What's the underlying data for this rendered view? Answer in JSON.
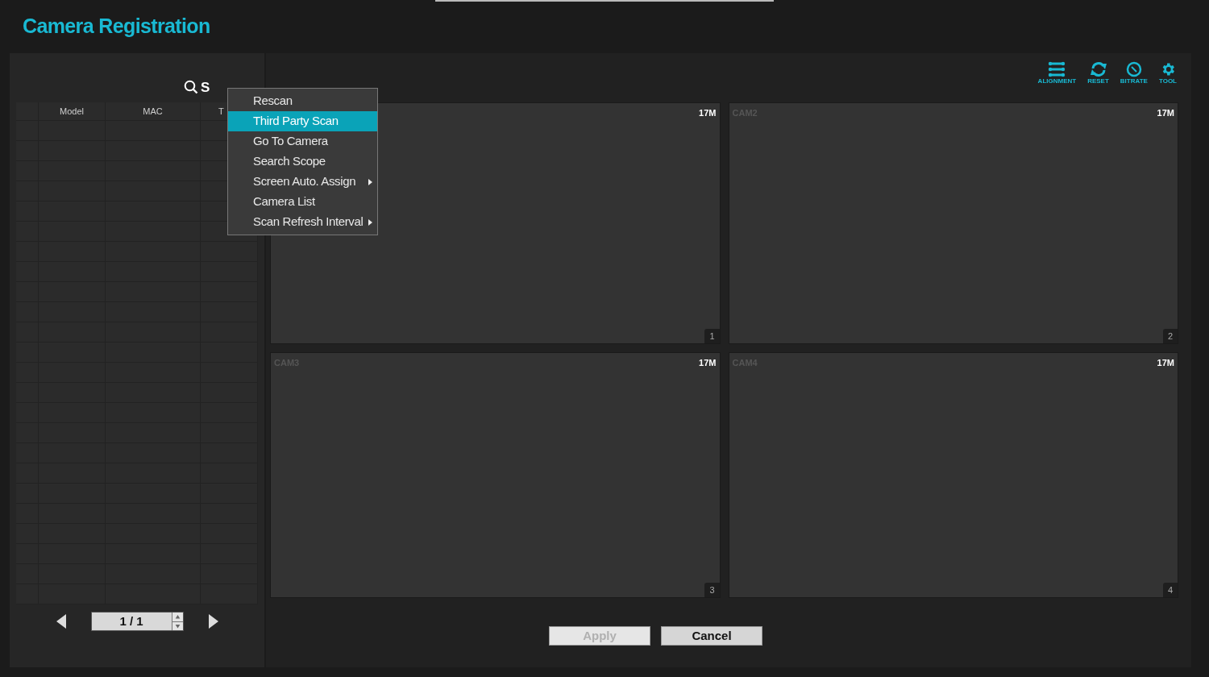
{
  "title": "Camera Registration",
  "scan_button": {
    "label": "S"
  },
  "table": {
    "columns": [
      "",
      "Model",
      "MAC",
      "T"
    ]
  },
  "pagination": {
    "value": "1 / 1"
  },
  "context_menu": [
    {
      "label": "Rescan",
      "selected": false,
      "has_submenu": false
    },
    {
      "label": "Third Party Scan",
      "selected": true,
      "has_submenu": false
    },
    {
      "label": "Go To Camera",
      "selected": false,
      "has_submenu": false
    },
    {
      "label": "Search Scope",
      "selected": false,
      "has_submenu": false
    },
    {
      "label": "Screen Auto. Assign",
      "selected": false,
      "has_submenu": true
    },
    {
      "label": "Camera List",
      "selected": false,
      "has_submenu": false
    },
    {
      "label": "Scan Refresh Interval",
      "selected": false,
      "has_submenu": true
    }
  ],
  "toolbar": [
    {
      "kind": "alignment",
      "label": "ALIGNMENT"
    },
    {
      "kind": "reset",
      "label": "RESET"
    },
    {
      "kind": "bitrate",
      "label": "BITRATE"
    },
    {
      "kind": "tool",
      "label": "TOOL"
    }
  ],
  "tiles": [
    {
      "resolution": "17M",
      "number": "1"
    },
    {
      "name": "CAM2",
      "resolution": "17M",
      "number": "2"
    },
    {
      "name": "CAM3",
      "resolution": "17M",
      "number": "3"
    },
    {
      "name": "CAM4",
      "resolution": "17M",
      "number": "4"
    }
  ],
  "buttons": [
    {
      "label": "Apply",
      "disabled": true
    },
    {
      "label": "Cancel",
      "disabled": false
    }
  ]
}
